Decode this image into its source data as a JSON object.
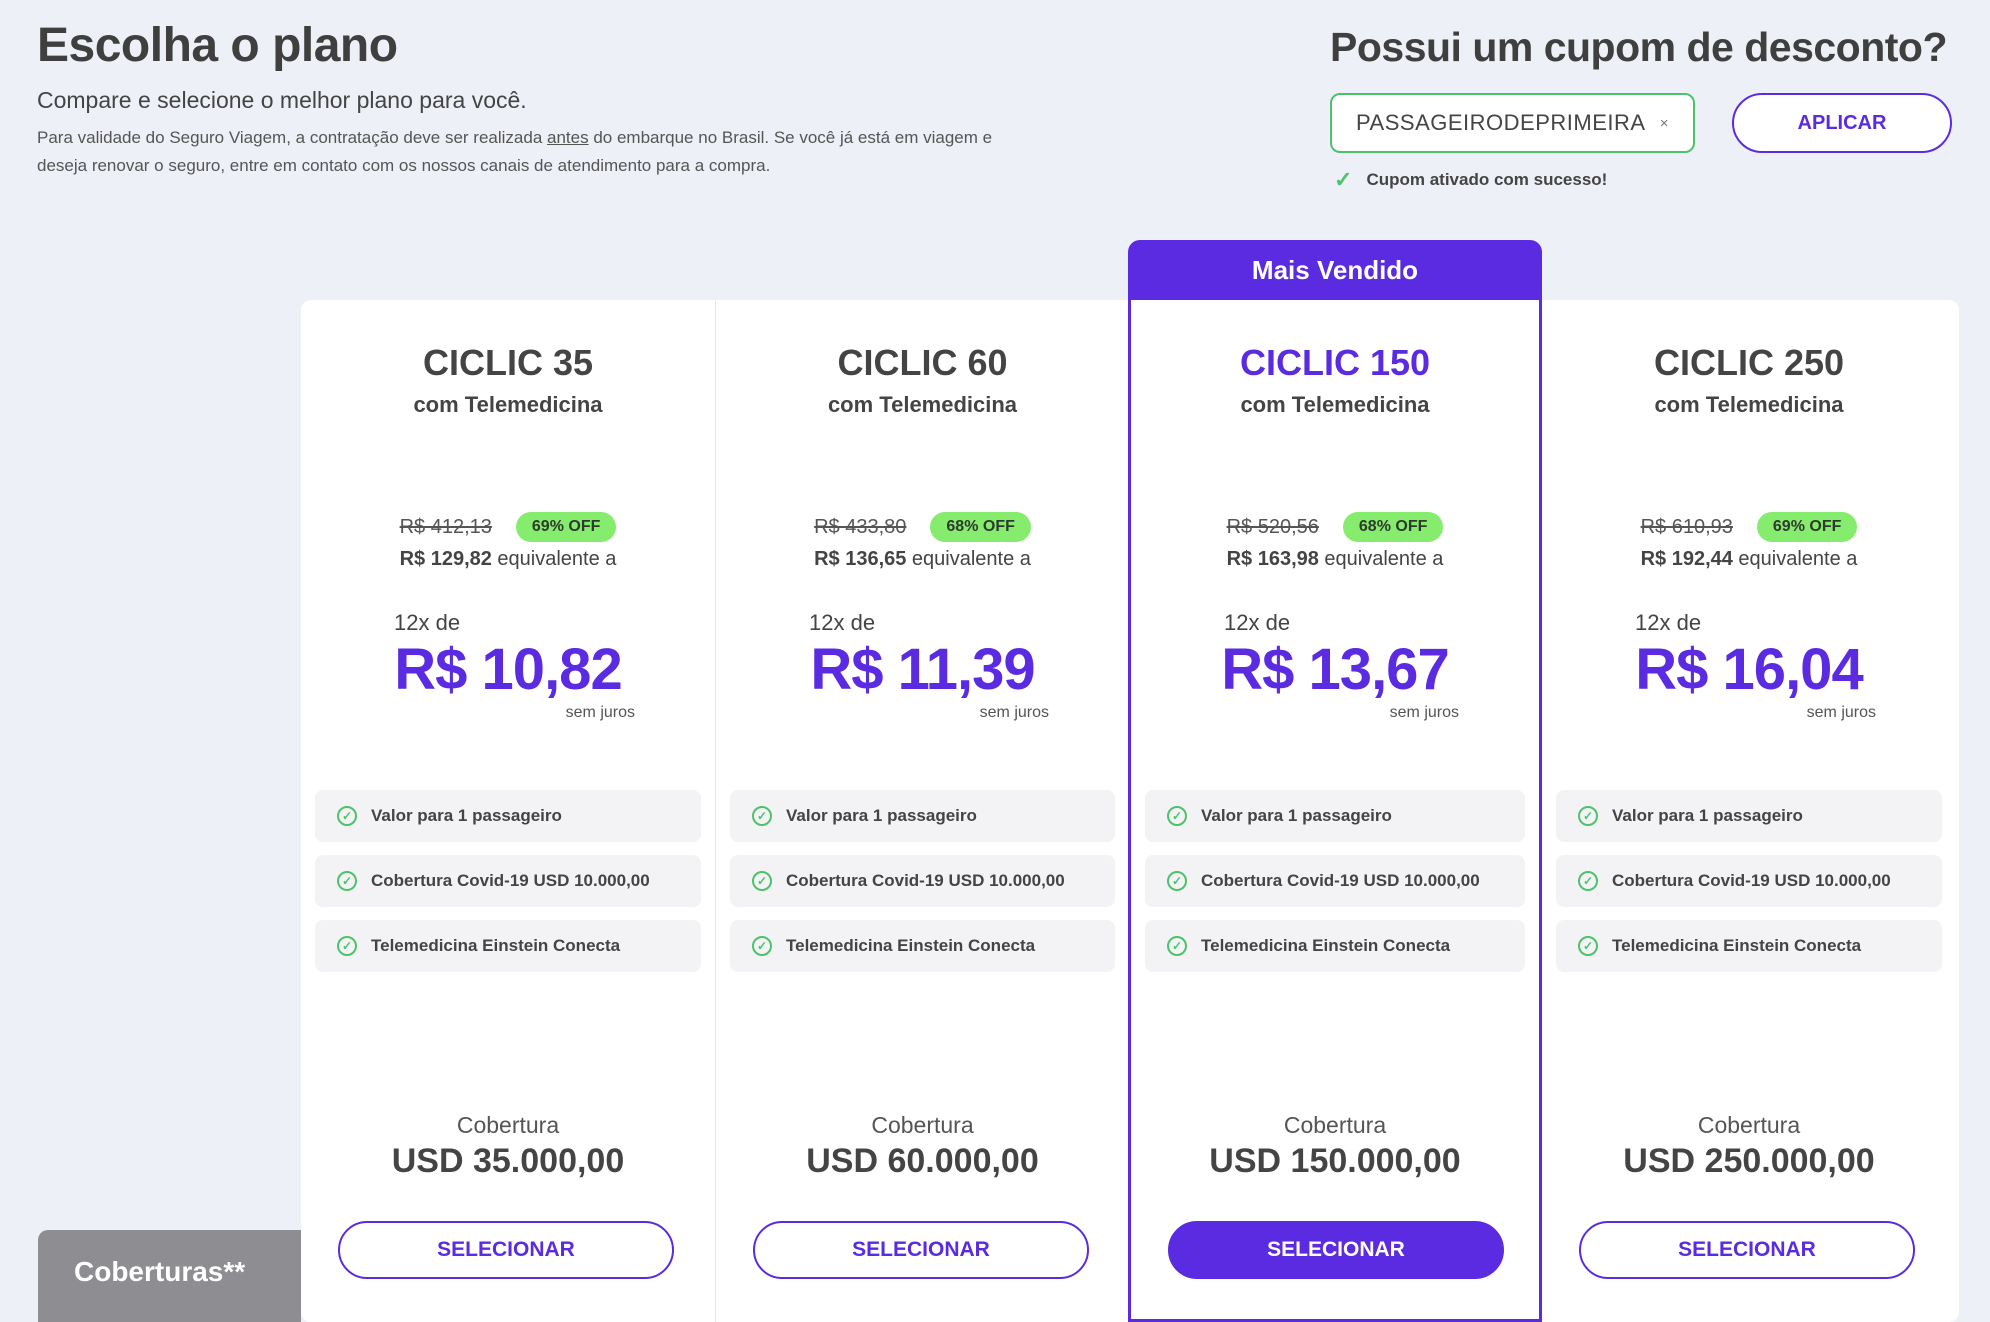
{
  "header": {
    "title": "Escolha o plano",
    "subtitle": "Compare e selecione o melhor plano para você.",
    "notice_pre": "Para validade do Seguro Viagem, a contratação deve ser realizada ",
    "notice_link": "antes",
    "notice_post": " do embarque no Brasil. Se você já está em viagem e deseja renovar o seguro, entre em contato com os nossos canais de atendimento para a compra."
  },
  "coupon": {
    "title": "Possui um cupom de desconto?",
    "value": "PASSAGEIRODEPRIMEIRA",
    "clear_label": "×",
    "apply_label": "APLICAR",
    "success_message": "Cupom ativado com sucesso!"
  },
  "badge": "Mais Vendido",
  "plans": [
    {
      "name": "CICLIC 35",
      "subtitle": "com Telemedicina",
      "old_price": "R$ 412,13",
      "discount": "69% OFF",
      "total": "R$ 129,82",
      "equiv_suffix": " equivalente a",
      "installments": "12x de",
      "installment_price": "R$ 10,82",
      "no_interest": "sem juros",
      "features": [
        "Valor para 1 passageiro",
        "Cobertura Covid-19 USD 10.000,00",
        "Telemedicina Einstein Conecta"
      ],
      "coverage_label": "Cobertura",
      "coverage_value": "USD 35.000,00",
      "select_label": "SELECIONAR"
    },
    {
      "name": "CICLIC 60",
      "subtitle": "com Telemedicina",
      "old_price": "R$ 433,80",
      "discount": "68% OFF",
      "total": "R$ 136,65",
      "equiv_suffix": " equivalente a",
      "installments": "12x de",
      "installment_price": "R$ 11,39",
      "no_interest": "sem juros",
      "features": [
        "Valor para 1 passageiro",
        "Cobertura Covid-19 USD 10.000,00",
        "Telemedicina Einstein Conecta"
      ],
      "coverage_label": "Cobertura",
      "coverage_value": "USD 60.000,00",
      "select_label": "SELECIONAR"
    },
    {
      "name": "CICLIC 150",
      "subtitle": "com Telemedicina",
      "old_price": "R$ 520,56",
      "discount": "68% OFF",
      "total": "R$ 163,98",
      "equiv_suffix": " equivalente a",
      "installments": "12x de",
      "installment_price": "R$ 13,67",
      "no_interest": "sem juros",
      "features": [
        "Valor para 1 passageiro",
        "Cobertura Covid-19 USD 10.000,00",
        "Telemedicina Einstein Conecta"
      ],
      "coverage_label": "Cobertura",
      "coverage_value": "USD 150.000,00",
      "select_label": "SELECIONAR"
    },
    {
      "name": "CICLIC 250",
      "subtitle": "com Telemedicina",
      "old_price": "R$ 610,93",
      "discount": "69% OFF",
      "total": "R$ 192,44",
      "equiv_suffix": " equivalente a",
      "installments": "12x de",
      "installment_price": "R$ 16,04",
      "no_interest": "sem juros",
      "features": [
        "Valor para 1 passageiro",
        "Cobertura Covid-19 USD 10.000,00",
        "Telemedicina Einstein Conecta"
      ],
      "coverage_label": "Cobertura",
      "coverage_value": "USD 250.000,00",
      "select_label": "SELECIONAR"
    }
  ],
  "coberturas_tab": "Coberturas**",
  "colors": {
    "accent": "#5a2be0",
    "success": "#4cc36a",
    "discount_badge": "#86ec6e"
  }
}
